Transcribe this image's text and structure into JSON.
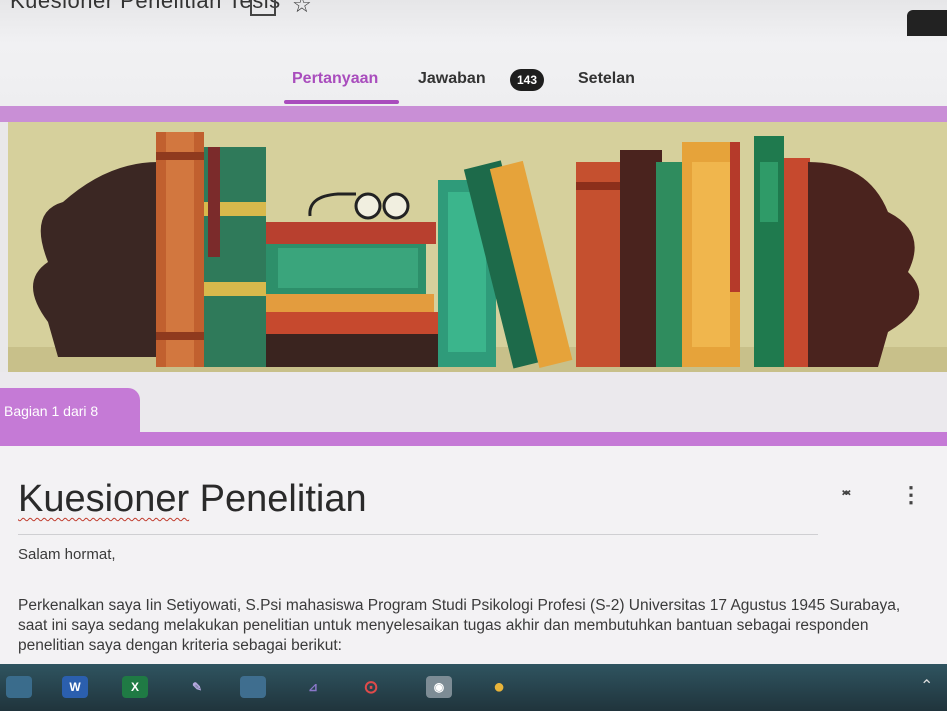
{
  "header": {
    "doc_title": "Kuesioner Penelitian Tesis",
    "tabs": {
      "questions": "Pertanyaan",
      "responses": "Jawaban",
      "responses_count": "143",
      "settings": "Setelan"
    }
  },
  "section": {
    "label": "Bagian 1 dari 8"
  },
  "form": {
    "title_part1": "Kuesioner",
    "title_part2": " Penelitian",
    "greeting": "Salam hormat,",
    "description": "Perkenalkan saya Iin Setiyowati, S.Psi mahasiswa Program Studi Psikologi Profesi (S-2) Universitas 17 Agustus 1945 Surabaya, saat ini saya sedang melakukan penelitian untuk menyelesaikan tugas akhir dan membutuhkan bantuan sebagai responden penelitian saya dengan kriteria sebagai berikut:"
  },
  "taskbar": {
    "apps": [
      "file-explorer",
      "word",
      "excel",
      "paint",
      "sticky-notes",
      "snipping-tool",
      "media-player",
      "camera",
      "chrome"
    ]
  },
  "colors": {
    "accent": "#a94dbd",
    "section_purple": "#c57ad6",
    "taskbar": "#2b4a55"
  }
}
